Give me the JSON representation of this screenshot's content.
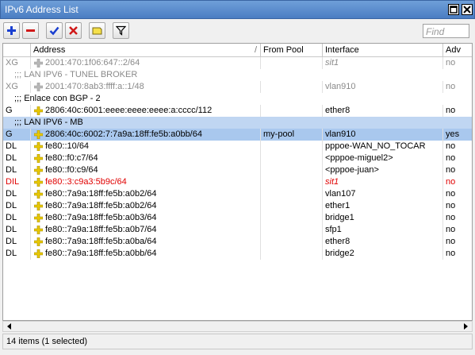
{
  "window": {
    "title": "IPv6 Address List"
  },
  "toolbar": {
    "find_placeholder": "Find"
  },
  "columns": {
    "flags": "",
    "address": "Address",
    "from_pool": "From Pool",
    "interface": "Interface",
    "advertise": "Adv"
  },
  "rows": [
    {
      "kind": "data",
      "style": "gray",
      "flags": "XG",
      "address": "2001:470:1f06:647::2/64",
      "pool": "",
      "interface": "sit1",
      "iface_italic": true,
      "adv": "no",
      "pin": "gray"
    },
    {
      "kind": "comment",
      "text": ";;; LAN IPV6 - TUNEL BROKER",
      "style": "gray"
    },
    {
      "kind": "data",
      "style": "gray",
      "flags": "XG",
      "address": "2001:470:8ab3:ffff:a::1/48",
      "pool": "",
      "interface": "vlan910",
      "iface_italic": false,
      "adv": "no",
      "pin": "gray"
    },
    {
      "kind": "comment",
      "text": ";;; Enlace con BGP - 2",
      "style": "normal"
    },
    {
      "kind": "data",
      "style": "normal",
      "flags": "G",
      "address": "2806:40c:6001:eeee:eeee:eeee:a:cccc/112",
      "pool": "",
      "interface": "ether8",
      "iface_italic": false,
      "adv": "no",
      "pin": "yellow"
    },
    {
      "kind": "comment",
      "text": ";;; LAN IPV6 - MB",
      "style": "sel"
    },
    {
      "kind": "data",
      "style": "sel",
      "flags": "G",
      "address": "2806:40c:6002:7:7a9a:18ff:fe5b:a0bb/64",
      "pool": "my-pool",
      "interface": "vlan910",
      "iface_italic": false,
      "adv": "yes",
      "pin": "yellow"
    },
    {
      "kind": "data",
      "style": "normal",
      "flags": "DL",
      "address": "fe80::10/64",
      "pool": "",
      "interface": "pppoe-WAN_NO_TOCAR",
      "iface_italic": false,
      "adv": "no",
      "pin": "yellow"
    },
    {
      "kind": "data",
      "style": "normal",
      "flags": "DL",
      "address": "fe80::f0:c7/64",
      "pool": "",
      "interface": "<pppoe-miguel2>",
      "iface_italic": false,
      "adv": "no",
      "pin": "yellow"
    },
    {
      "kind": "data",
      "style": "normal",
      "flags": "DL",
      "address": "fe80::f0:c9/64",
      "pool": "",
      "interface": "<pppoe-juan>",
      "iface_italic": false,
      "adv": "no",
      "pin": "yellow"
    },
    {
      "kind": "data",
      "style": "red",
      "flags": "DIL",
      "address": "fe80::3:c9a3:5b9c/64",
      "pool": "",
      "interface": "sit1",
      "iface_italic": true,
      "adv": "no",
      "pin": "yellow"
    },
    {
      "kind": "data",
      "style": "normal",
      "flags": "DL",
      "address": "fe80::7a9a:18ff:fe5b:a0b2/64",
      "pool": "",
      "interface": "vlan107",
      "iface_italic": false,
      "adv": "no",
      "pin": "yellow"
    },
    {
      "kind": "data",
      "style": "normal",
      "flags": "DL",
      "address": "fe80::7a9a:18ff:fe5b:a0b2/64",
      "pool": "",
      "interface": "ether1",
      "iface_italic": false,
      "adv": "no",
      "pin": "yellow"
    },
    {
      "kind": "data",
      "style": "normal",
      "flags": "DL",
      "address": "fe80::7a9a:18ff:fe5b:a0b3/64",
      "pool": "",
      "interface": "bridge1",
      "iface_italic": false,
      "adv": "no",
      "pin": "yellow"
    },
    {
      "kind": "data",
      "style": "normal",
      "flags": "DL",
      "address": "fe80::7a9a:18ff:fe5b:a0b7/64",
      "pool": "",
      "interface": "sfp1",
      "iface_italic": false,
      "adv": "no",
      "pin": "yellow"
    },
    {
      "kind": "data",
      "style": "normal",
      "flags": "DL",
      "address": "fe80::7a9a:18ff:fe5b:a0ba/64",
      "pool": "",
      "interface": "ether8",
      "iface_italic": false,
      "adv": "no",
      "pin": "yellow"
    },
    {
      "kind": "data",
      "style": "normal",
      "flags": "DL",
      "address": "fe80::7a9a:18ff:fe5b:a0bb/64",
      "pool": "",
      "interface": "bridge2",
      "iface_italic": false,
      "adv": "no",
      "pin": "yellow"
    }
  ],
  "status": {
    "text": "14 items (1 selected)"
  },
  "colors": {
    "title_bar": "#4a7dc2",
    "selection": "#a9c8ee",
    "disabled_text": "#8a8a8a",
    "invalid_text": "#e00000",
    "pin_yellow": "#e8c800"
  }
}
